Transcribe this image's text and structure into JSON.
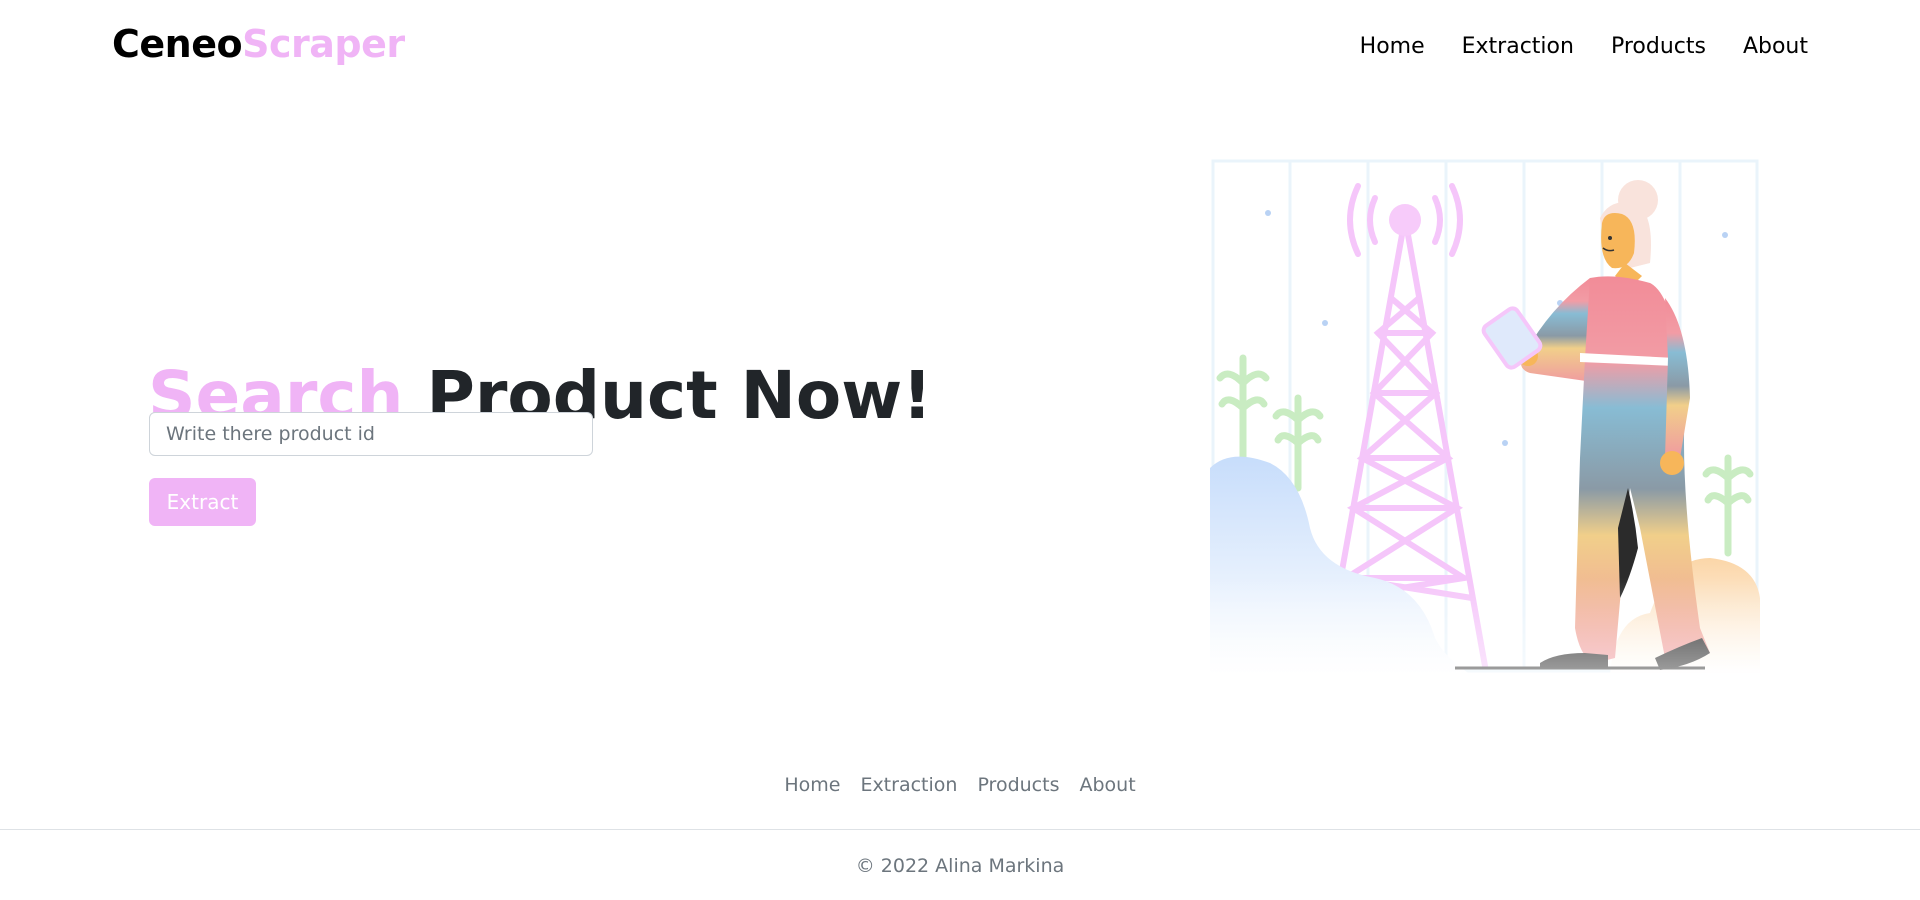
{
  "brand": {
    "part1": "Ceneo",
    "part2": "Scraper"
  },
  "nav": {
    "items": [
      {
        "label": "Home"
      },
      {
        "label": "Extraction"
      },
      {
        "label": "Products"
      },
      {
        "label": "About"
      }
    ]
  },
  "hero": {
    "title_accent": "Search",
    "title_rest": " Product Now!",
    "input": {
      "placeholder": "Write there product id",
      "value": ""
    },
    "button_label": "Extract"
  },
  "footer": {
    "links": [
      {
        "label": "Home"
      },
      {
        "label": "Extraction"
      },
      {
        "label": "Products"
      },
      {
        "label": "About"
      }
    ],
    "copyright": "© 2022 Alina Markina"
  },
  "colors": {
    "accent": "#f0b4f6",
    "text_dark": "#212529",
    "text_muted": "#6c757d"
  },
  "icons": {
    "illustration": "woman-with-phone-near-radio-tower-illustration"
  }
}
